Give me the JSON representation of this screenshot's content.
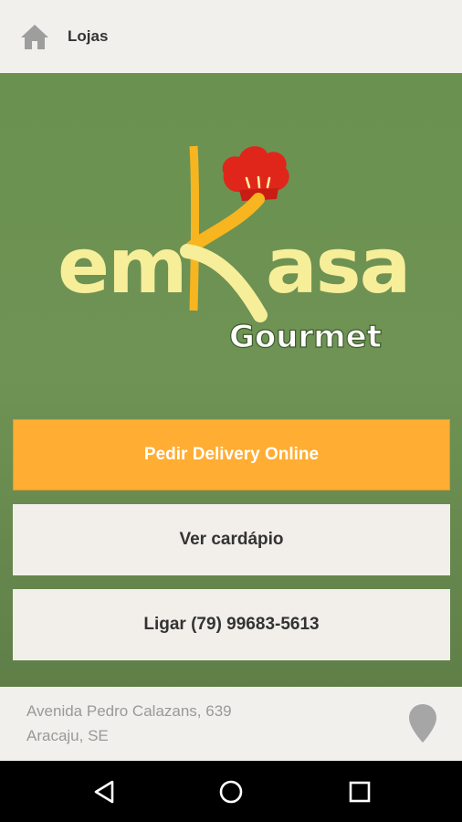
{
  "topbar": {
    "title": "Lojas",
    "icon": "home-icon"
  },
  "logo": {
    "text_em": "em",
    "text_k": "K",
    "text_asa": "asa",
    "text_gourmet": "Gourmet",
    "icon": "chef-hat-icon"
  },
  "actions": {
    "delivery_label": "Pedir Delivery Online",
    "menu_label": "Ver cardápio",
    "call_label": "Ligar (79) 99683-5613"
  },
  "footer": {
    "address_line1": "Avenida Pedro Calazans, 639",
    "address_line2": "Aracaju, SE",
    "icon": "map-pin-icon"
  },
  "navbar": {
    "back_icon": "back-icon",
    "home_icon": "home-circle-icon",
    "recent_icon": "recent-apps-icon"
  },
  "colors": {
    "accent": "#ffad33",
    "hero_green": "#6f9354",
    "bar_bg": "#f2f0ed",
    "logo_yellow": "#f7ee9a",
    "logo_red": "#e0261b"
  }
}
